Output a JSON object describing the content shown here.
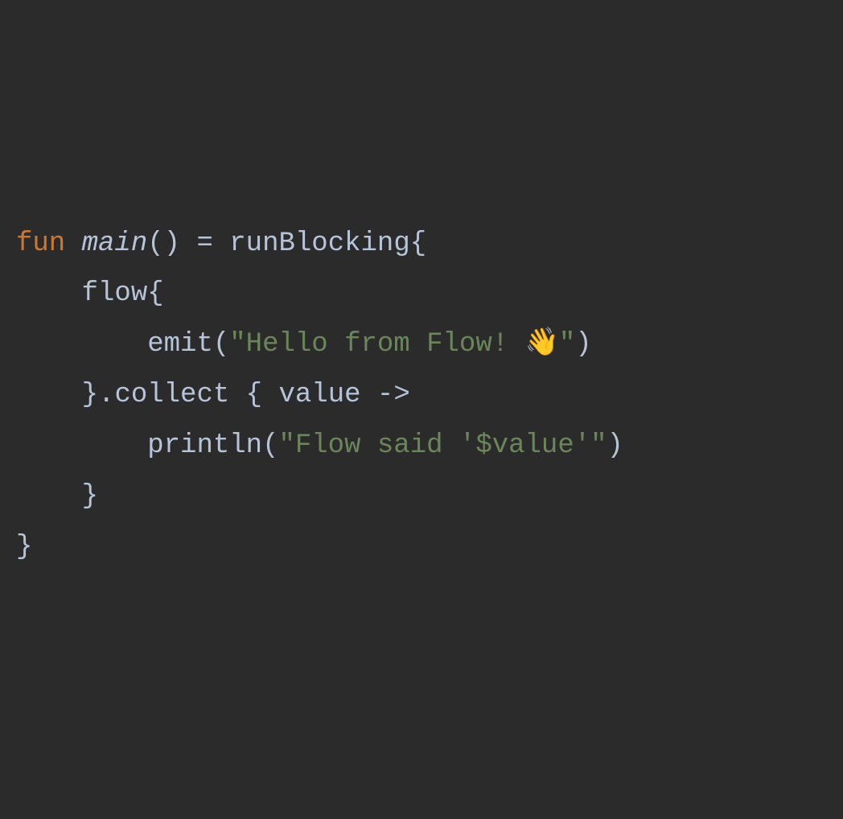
{
  "code": {
    "line1": {
      "keyword_fun": "fun",
      "funcname": "main",
      "parens": "()",
      "equals": " = ",
      "runBlocking": "runBlocking",
      "brace": "{"
    },
    "line2": {
      "indent": "    ",
      "flow": "flow",
      "brace": "{"
    },
    "line3": {
      "indent": "        ",
      "emit": "emit",
      "paren_open": "(",
      "string": "\"Hello from Flow! 👋\"",
      "paren_close": ")"
    },
    "line4": {
      "indent": "    ",
      "brace_close": "}",
      "dot": ".",
      "collect": "collect",
      "space_brace": " { ",
      "value": "value",
      "arrow": " ->"
    },
    "line5": {
      "indent": "        ",
      "println": "println",
      "paren_open": "(",
      "string_part1": "\"Flow said '",
      "interp": "$value",
      "string_part2": "'\"",
      "paren_close": ")"
    },
    "line6": {
      "indent": "    ",
      "brace": "}"
    },
    "line7": {
      "brace": "}"
    }
  }
}
